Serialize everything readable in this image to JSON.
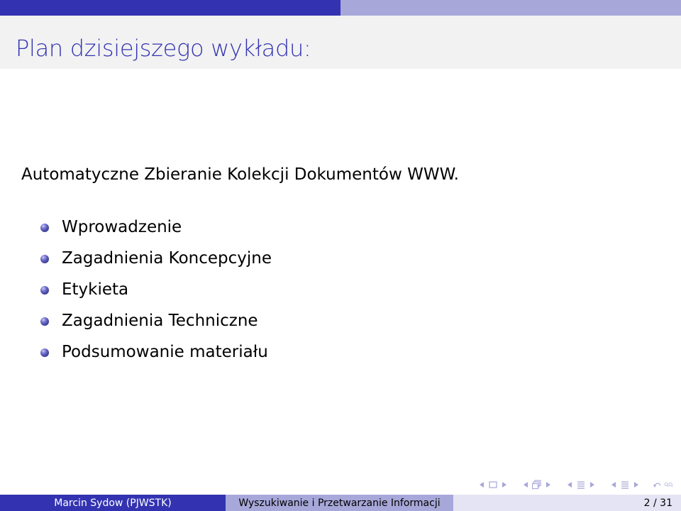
{
  "slide": {
    "title": "Plan dzisiejszego wykładu:",
    "intro": "Automatyczne Zbieranie Kolekcji Dokumentów WWW.",
    "items": [
      "Wprowadzenie",
      "Zagadnienia Koncepcyjne",
      "Etykieta",
      "Zagadnienia Techniczne",
      "Podsumowanie materiału"
    ]
  },
  "footer": {
    "author": "Marcin Sydow (PJWSTK)",
    "course": "Wyszukiwanie i Przetwarzanie Informacji",
    "page": "2 / 31"
  },
  "colors": {
    "accent": "#3333b2",
    "accent_light": "#a7a7d9",
    "footer_right": "#e4e4f4",
    "title_band": "#f2f2f2"
  },
  "icons": [
    "nav-prev-frame-icon",
    "nav-next-frame-icon",
    "nav-prev-subsection-icon",
    "nav-next-subsection-icon",
    "nav-prev-section-icon",
    "nav-next-section-icon",
    "nav-document-icon",
    "nav-search-icon"
  ]
}
